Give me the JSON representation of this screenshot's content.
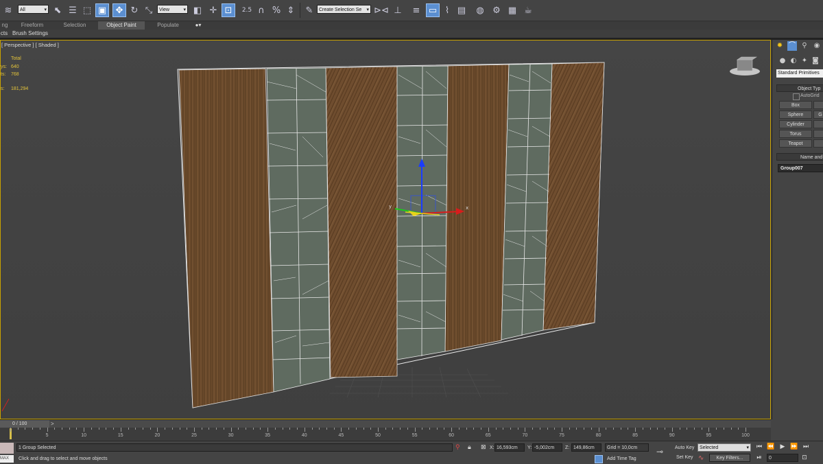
{
  "toolbar": {
    "selection_filter": "All",
    "ref_coord": "View",
    "named_selection": "Create Selection Se",
    "spinner_snap": "2.5"
  },
  "ribbon": {
    "tabs": [
      "ng",
      "Freeform",
      "Selection",
      "Object Paint",
      "Populate"
    ],
    "active_tab": "Object Paint",
    "sub_items": [
      "cts",
      "Brush Settings"
    ]
  },
  "viewport": {
    "label": "[ Perspective ] [ Shaded ]",
    "stats": {
      "total_label": "Total",
      "polys_label": "ys:",
      "polys": "640",
      "verts_label": "ts:",
      "verts": "768",
      "fps_label": "s:",
      "fps": "181,294"
    },
    "gizmo_axes": {
      "x": "x",
      "y": "y"
    }
  },
  "command_panel": {
    "category": "Standard Primitives",
    "object_type_header": "Object Typ",
    "autogrid": "AutoGrid",
    "buttons": [
      "Box",
      "Sphere",
      "Cylinder",
      "Torus",
      "Teapot"
    ],
    "buttons2": [
      "",
      "G",
      "",
      "",
      ""
    ],
    "name_color_header": "Name and Co",
    "object_name": "Group007"
  },
  "timeline": {
    "frame_display": "0 / 100",
    "ticks": [
      "5",
      "10",
      "15",
      "20",
      "25",
      "30",
      "35",
      "40",
      "45",
      "50",
      "55",
      "60",
      "65",
      "70",
      "75",
      "80",
      "85",
      "90",
      "95",
      "100"
    ]
  },
  "status": {
    "selection_status": "1 Group Selected",
    "prompt": "Click and drag to select and move objects",
    "mini_listener": "MAX",
    "x_label": "X:",
    "x_value": "16,593cm",
    "y_label": "Y:",
    "y_value": "-5,002cm",
    "z_label": "Z:",
    "z_value": "149,86cm",
    "grid": "Grid = 10,0cm",
    "add_time_tag": "Add Time Tag",
    "auto_key": "Auto Key",
    "set_key": "Set Key",
    "key_mode_select": "Selected",
    "key_filters": "Key Filters...",
    "current_frame": "0"
  },
  "colors": {
    "viewport_border": "#c9a200",
    "wood": "#6b4a2c",
    "glass": "#5f6b60",
    "stats_text": "#e4c43a"
  }
}
